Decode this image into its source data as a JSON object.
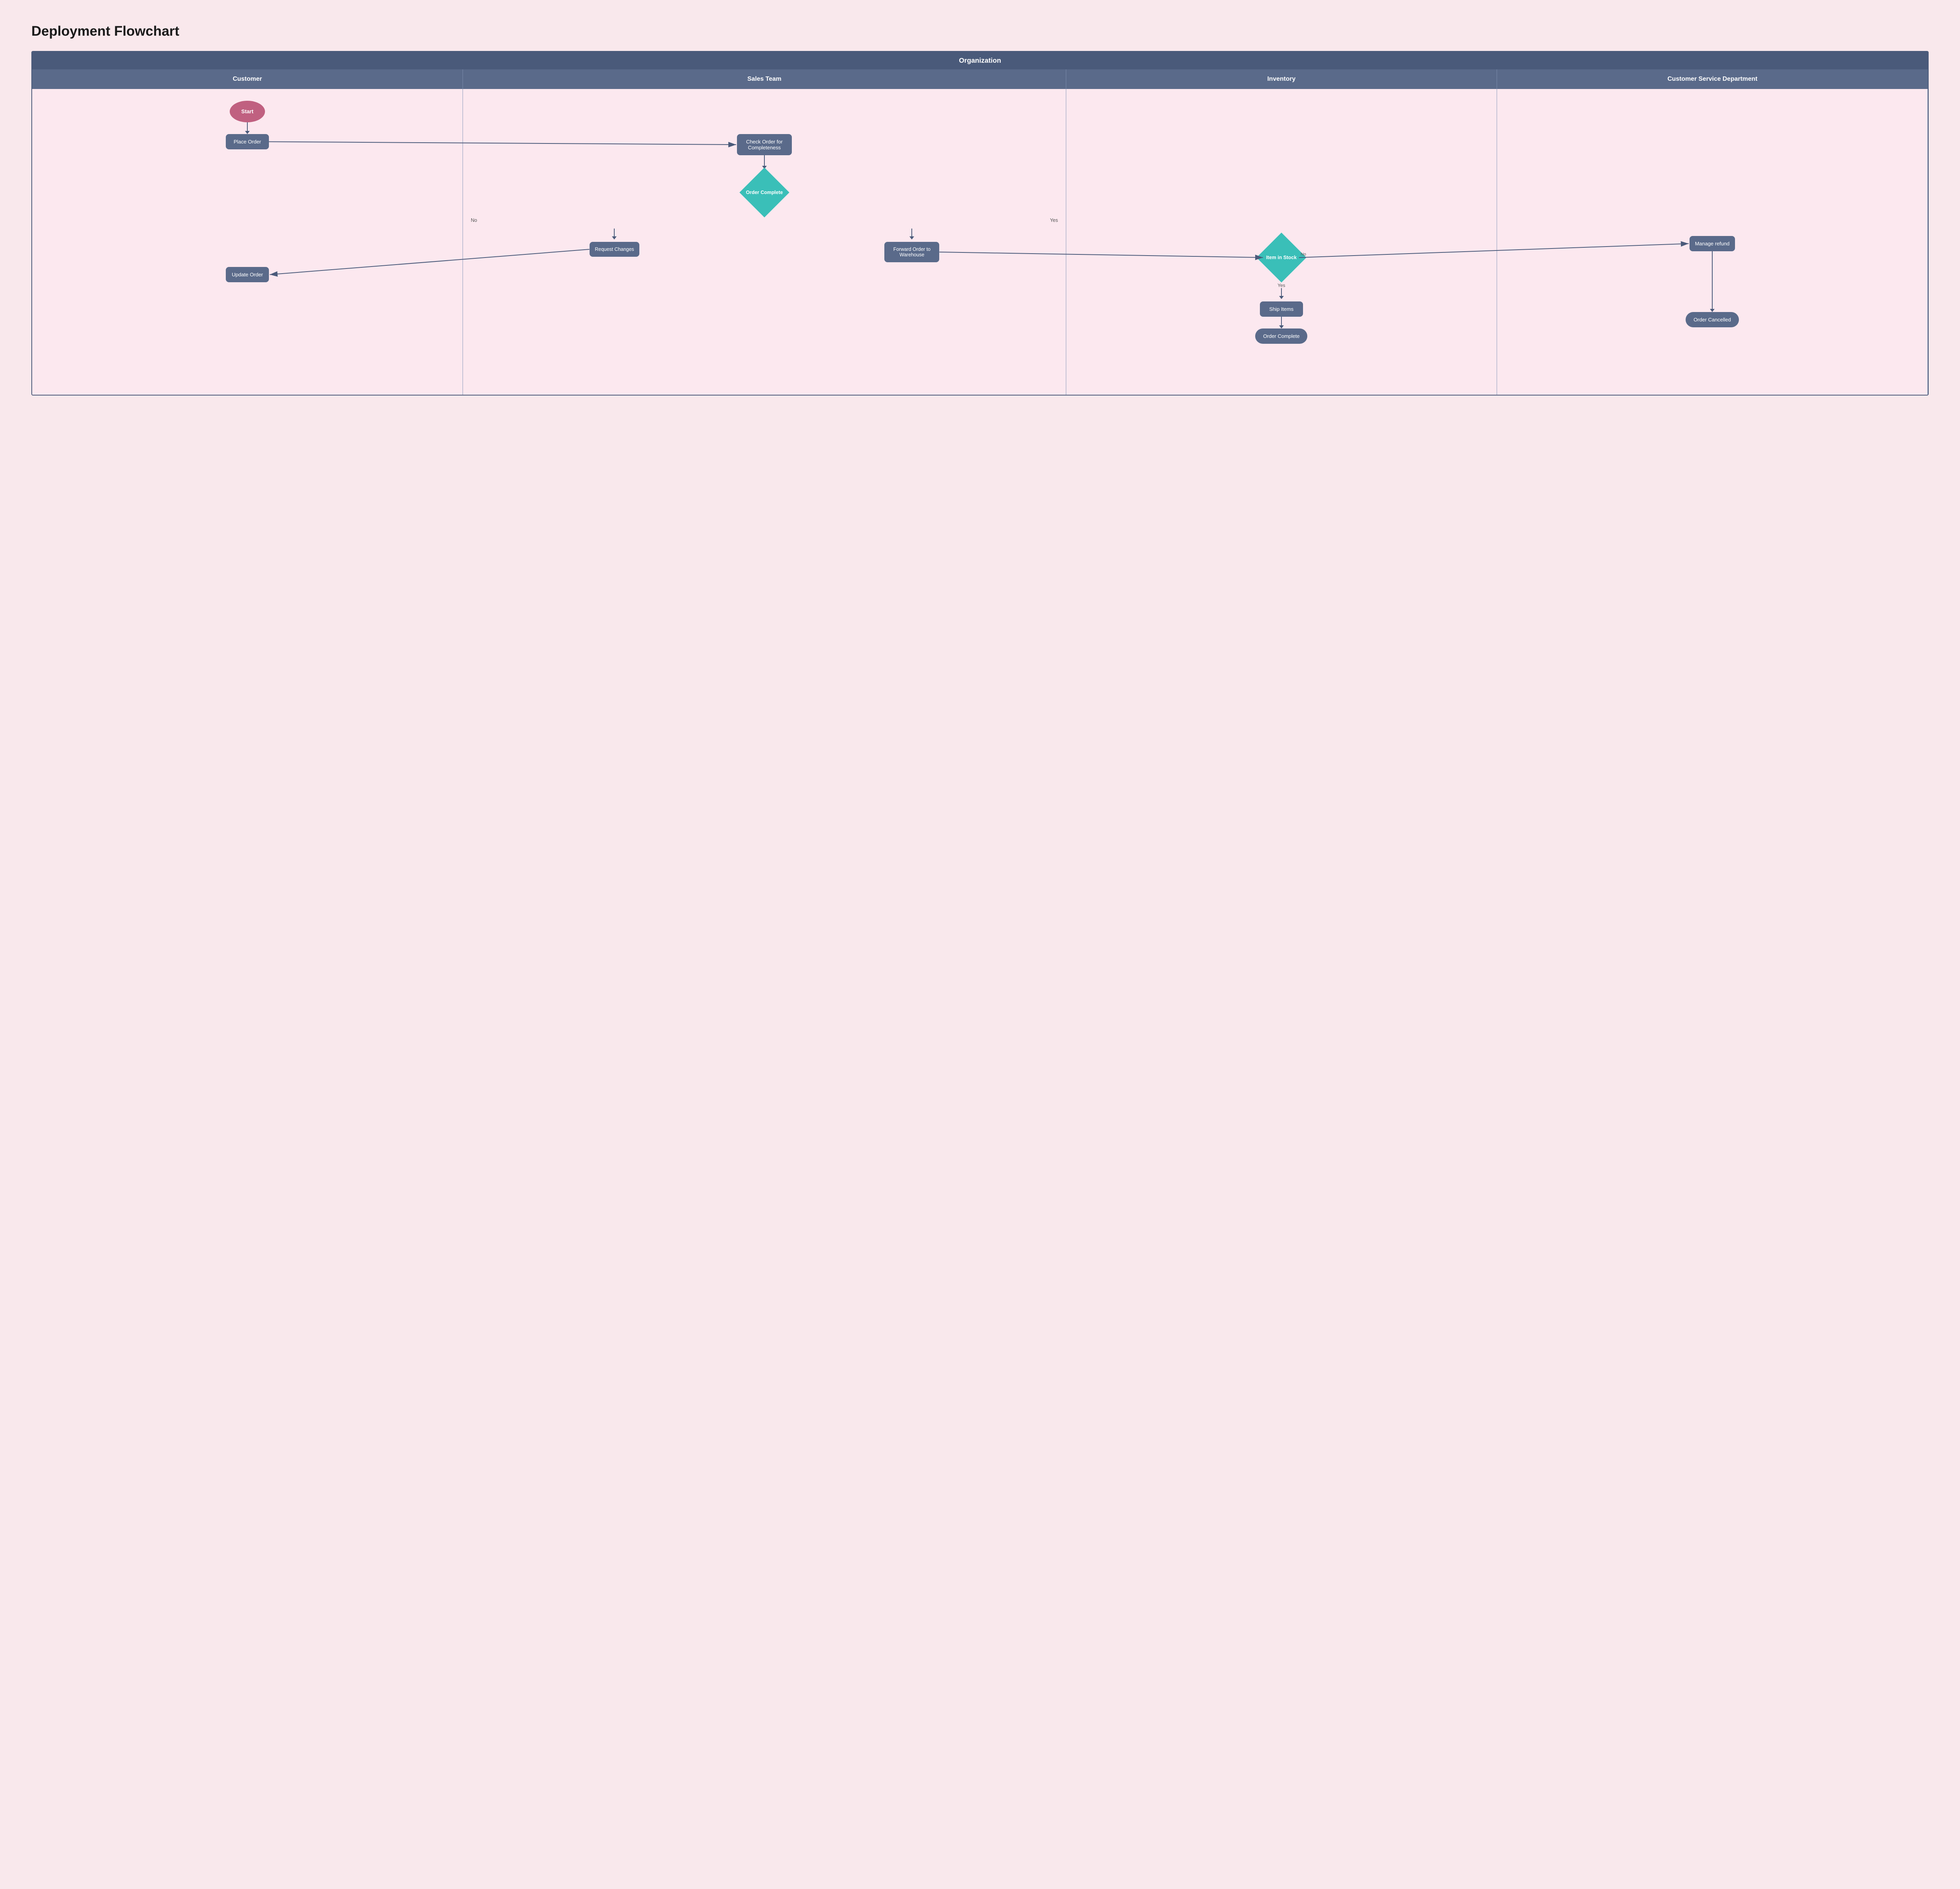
{
  "title": "Deployment Flowchart",
  "org_label": "Organization",
  "columns": [
    {
      "id": "customer",
      "label": "Customer"
    },
    {
      "id": "sales",
      "label": "Sales Team"
    },
    {
      "id": "inventory",
      "label": "Inventory"
    },
    {
      "id": "csd",
      "label": "Customer Service Department"
    }
  ],
  "nodes": {
    "start": "Start",
    "place_order": "Place Order",
    "check_order": "Check Order for Completeness",
    "order_complete_diamond": "Order Complete",
    "request_changes": "Request Changes",
    "forward_order": "Forward Order to Warehouse",
    "update_order": "Update Order",
    "item_in_stock": "Item in Stock",
    "ship_items": "Ship Items",
    "order_complete_end": "Order Complete",
    "manage_refund": "Manage refund",
    "order_cancelled": "Order Cancelled"
  },
  "labels": {
    "yes": "Yes",
    "no": "No"
  },
  "colors": {
    "background": "#f9e8ec",
    "diagram_bg": "#fce8ef",
    "header_dark": "#4a5a7a",
    "header_mid": "#5a6a8a",
    "node_rect": "#5a6a8a",
    "node_oval_start": "#c06080",
    "node_diamond": "#3abfb8",
    "arrow": "#4a5a7a",
    "border": "#8a9aba"
  }
}
